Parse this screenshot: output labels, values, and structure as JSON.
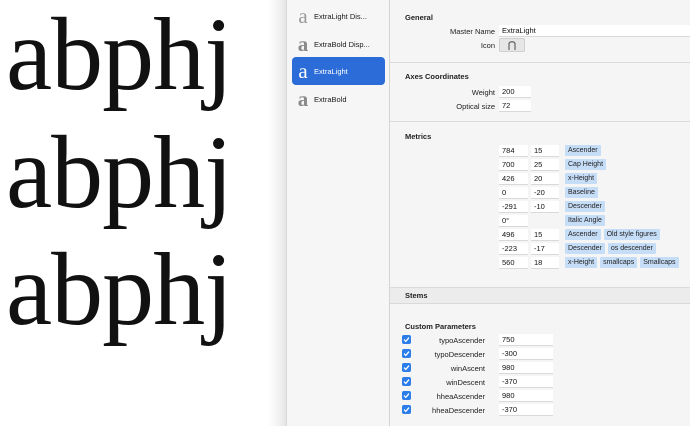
{
  "preview": {
    "lines": [
      "abphj",
      "abphj",
      "abphj"
    ]
  },
  "masters": {
    "items": [
      {
        "glyph": "a",
        "label": "ExtraLight Dis...",
        "selected": false,
        "bold": false
      },
      {
        "glyph": "a",
        "label": "ExtraBold Disp...",
        "selected": false,
        "bold": true
      },
      {
        "glyph": "a",
        "label": "ExtraLight",
        "selected": true,
        "bold": false
      },
      {
        "glyph": "a",
        "label": "ExtraBold",
        "selected": false,
        "bold": true
      }
    ]
  },
  "general": {
    "heading": "General",
    "master_name_label": "Master Name",
    "master_name_value": "ExtraLight",
    "icon_label": "Icon"
  },
  "axes": {
    "heading": "Axes Coordinates",
    "rows": [
      {
        "label": "Weight",
        "value": "200"
      },
      {
        "label": "Optical size",
        "value": "72"
      }
    ]
  },
  "metrics": {
    "heading": "Metrics",
    "rows": [
      {
        "value": "784",
        "overshoot": "15",
        "tags": [
          "Ascender"
        ]
      },
      {
        "value": "700",
        "overshoot": "25",
        "tags": [
          "Cap Height"
        ]
      },
      {
        "value": "426",
        "overshoot": "20",
        "tags": [
          "x-Height"
        ]
      },
      {
        "value": "0",
        "overshoot": "-20",
        "tags": [
          "Baseline"
        ]
      },
      {
        "value": "-291",
        "overshoot": "-10",
        "tags": [
          "Descender"
        ]
      },
      {
        "value": "0°",
        "overshoot": "",
        "tags": [
          "Italic Angle"
        ]
      },
      {
        "value": "496",
        "overshoot": "15",
        "tags": [
          "Ascender",
          "Old style figures"
        ]
      },
      {
        "value": "-223",
        "overshoot": "-17",
        "tags": [
          "Descender",
          "os descender"
        ]
      },
      {
        "value": "560",
        "overshoot": "18",
        "tags": [
          "x-Height",
          "smallcaps",
          "Smallcaps"
        ]
      }
    ]
  },
  "stems": {
    "heading": "Stems"
  },
  "custom_parameters": {
    "heading": "Custom Parameters",
    "rows": [
      {
        "checked": true,
        "label": "typoAscender",
        "value": "750"
      },
      {
        "checked": true,
        "label": "typoDescender",
        "value": "-300"
      },
      {
        "checked": true,
        "label": "winAscent",
        "value": "980"
      },
      {
        "checked": true,
        "label": "winDescent",
        "value": "-370"
      },
      {
        "checked": true,
        "label": "hheaAscender",
        "value": "980"
      },
      {
        "checked": true,
        "label": "hheaDescender",
        "value": "-370"
      }
    ]
  },
  "colors": {
    "accent": "#2b6cd9",
    "tag_bg": "#c6ddf8",
    "checkbox": "#2b7de9"
  }
}
